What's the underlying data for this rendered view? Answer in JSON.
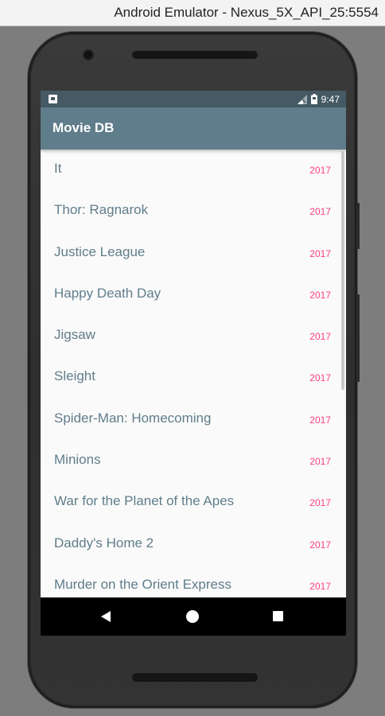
{
  "window": {
    "title": "Android Emulator - Nexus_5X_API_25:5554"
  },
  "status_bar": {
    "time": "9:47",
    "icons": [
      "notification-icon",
      "signal-icon",
      "battery-icon"
    ]
  },
  "app_bar": {
    "title": "Movie DB"
  },
  "movies": [
    {
      "title": "It",
      "year": "2017"
    },
    {
      "title": "Thor: Ragnarok",
      "year": "2017"
    },
    {
      "title": "Justice League",
      "year": "2017"
    },
    {
      "title": "Happy Death Day",
      "year": "2017"
    },
    {
      "title": "Jigsaw",
      "year": "2017"
    },
    {
      "title": "Sleight",
      "year": "2017"
    },
    {
      "title": "Spider-Man: Homecoming",
      "year": "2017"
    },
    {
      "title": "Minions",
      "year": "2017"
    },
    {
      "title": "War for the Planet of the Apes",
      "year": "2017"
    },
    {
      "title": "Daddy's Home 2",
      "year": "2017"
    },
    {
      "title": "Murder on the Orient Express",
      "year": "2017"
    }
  ],
  "nav_bar": {
    "icons": [
      "back-icon",
      "home-icon",
      "recents-icon"
    ]
  },
  "colors": {
    "status_bar": "#455a64",
    "app_bar": "#607d8b",
    "title_text": "#607d8b",
    "year_accent": "#ff4081",
    "list_bg": "#fafafa"
  }
}
